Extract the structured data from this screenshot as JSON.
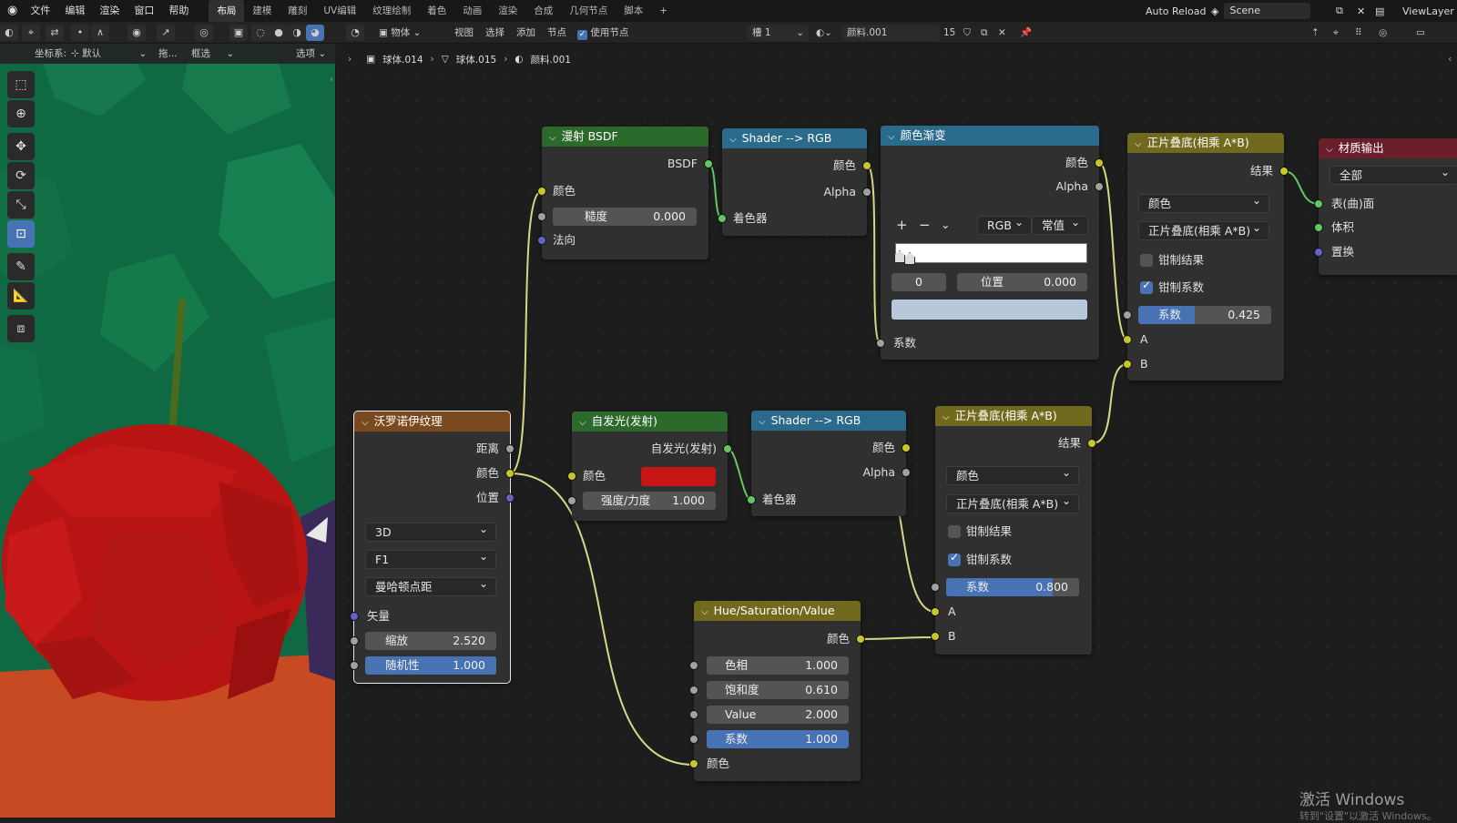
{
  "topbar": {
    "menus": [
      "文件",
      "编辑",
      "渲染",
      "窗口",
      "帮助"
    ],
    "workspaces": [
      "布局",
      "建模",
      "雕刻",
      "UV编辑",
      "纹理绘制",
      "着色",
      "动画",
      "渲染",
      "合成",
      "几何节点",
      "脚本"
    ],
    "active_workspace": "布局",
    "add_tab": "+",
    "auto_reload": "Auto Reload",
    "scene": "Scene",
    "view_layer": "ViewLayer"
  },
  "editor_header": {
    "object_mode": "物体",
    "menus": [
      "视图",
      "选择",
      "添加",
      "节点"
    ],
    "use_nodes": "使用节点",
    "slot": "槽 1",
    "material": "颜料.001",
    "users": "15"
  },
  "viewport_header": {
    "coord_label": "坐标系:",
    "coord_value": "默认",
    "drag_label": "拖...",
    "select_mode": "框选",
    "options": "选项"
  },
  "breadcrumb": [
    "球体.014",
    "球体.015",
    "颜料.001"
  ],
  "nodes": {
    "diffuse": {
      "title": "漫射 BSDF",
      "out": "BSDF",
      "color": "颜色",
      "roughness": "糙度",
      "roughness_val": "0.000",
      "normal": "法向"
    },
    "s2r1": {
      "title": "Shader --> RGB",
      "color": "颜色",
      "alpha": "Alpha",
      "shader": "着色器"
    },
    "ramp": {
      "title": "颜色渐变",
      "color": "颜色",
      "alpha": "Alpha",
      "mode": "RGB",
      "interp": "常值",
      "index": "0",
      "pos_label": "位置",
      "pos_val": "0.000",
      "fac": "系数"
    },
    "mix1": {
      "title": "正片叠底(相乘 A*B)",
      "result": "结果",
      "type": "颜色",
      "blend": "正片叠底(相乘 A*B)",
      "clamp_result": "钳制结果",
      "clamp_factor": "钳制系数",
      "fac": "系数",
      "fac_val": "0.425",
      "a": "A",
      "b": "B"
    },
    "output": {
      "title": "材质输出",
      "target": "全部",
      "surface": "表(曲)面",
      "volume": "体积",
      "displace": "置换"
    },
    "voronoi": {
      "title": "沃罗诺伊纹理",
      "distance": "距离",
      "color": "颜色",
      "position": "位置",
      "dim": "3D",
      "feature": "F1",
      "metric": "曼哈顿点距",
      "vector": "矢量",
      "scale": "缩放",
      "scale_val": "2.520",
      "random": "随机性",
      "random_val": "1.000"
    },
    "emission": {
      "title": "自发光(发射)",
      "out": "自发光(发射)",
      "color": "颜色",
      "strength": "强度/力度",
      "strength_val": "1.000"
    },
    "s2r2": {
      "title": "Shader --> RGB",
      "color": "颜色",
      "alpha": "Alpha",
      "shader": "着色器"
    },
    "mix2": {
      "title": "正片叠底(相乘 A*B)",
      "result": "结果",
      "type": "颜色",
      "blend": "正片叠底(相乘 A*B)",
      "clamp_result": "钳制结果",
      "clamp_factor": "钳制系数",
      "fac": "系数",
      "fac_val": "0.800",
      "a": "A",
      "b": "B"
    },
    "hsv": {
      "title": "Hue/Saturation/Value",
      "color_out": "颜色",
      "hue": "色相",
      "hue_val": "1.000",
      "sat": "饱和度",
      "sat_val": "0.610",
      "val": "Value",
      "val_val": "2.000",
      "fac": "系数",
      "fac_val": "1.000",
      "color_in": "颜色"
    }
  },
  "colors": {
    "emission_color": "#c71515",
    "ramp_swatch": "#b8c8dc",
    "shader_header": "#2a6a8a",
    "color_header": "#716a1e",
    "texture_header": "#7a4a1e",
    "output_header": "#6a1e2a",
    "bsdf_header": "#2b6a2b"
  },
  "watermark": "激活 Windows",
  "watermark_sub": "转到\"设置\"以激活 Windows。"
}
